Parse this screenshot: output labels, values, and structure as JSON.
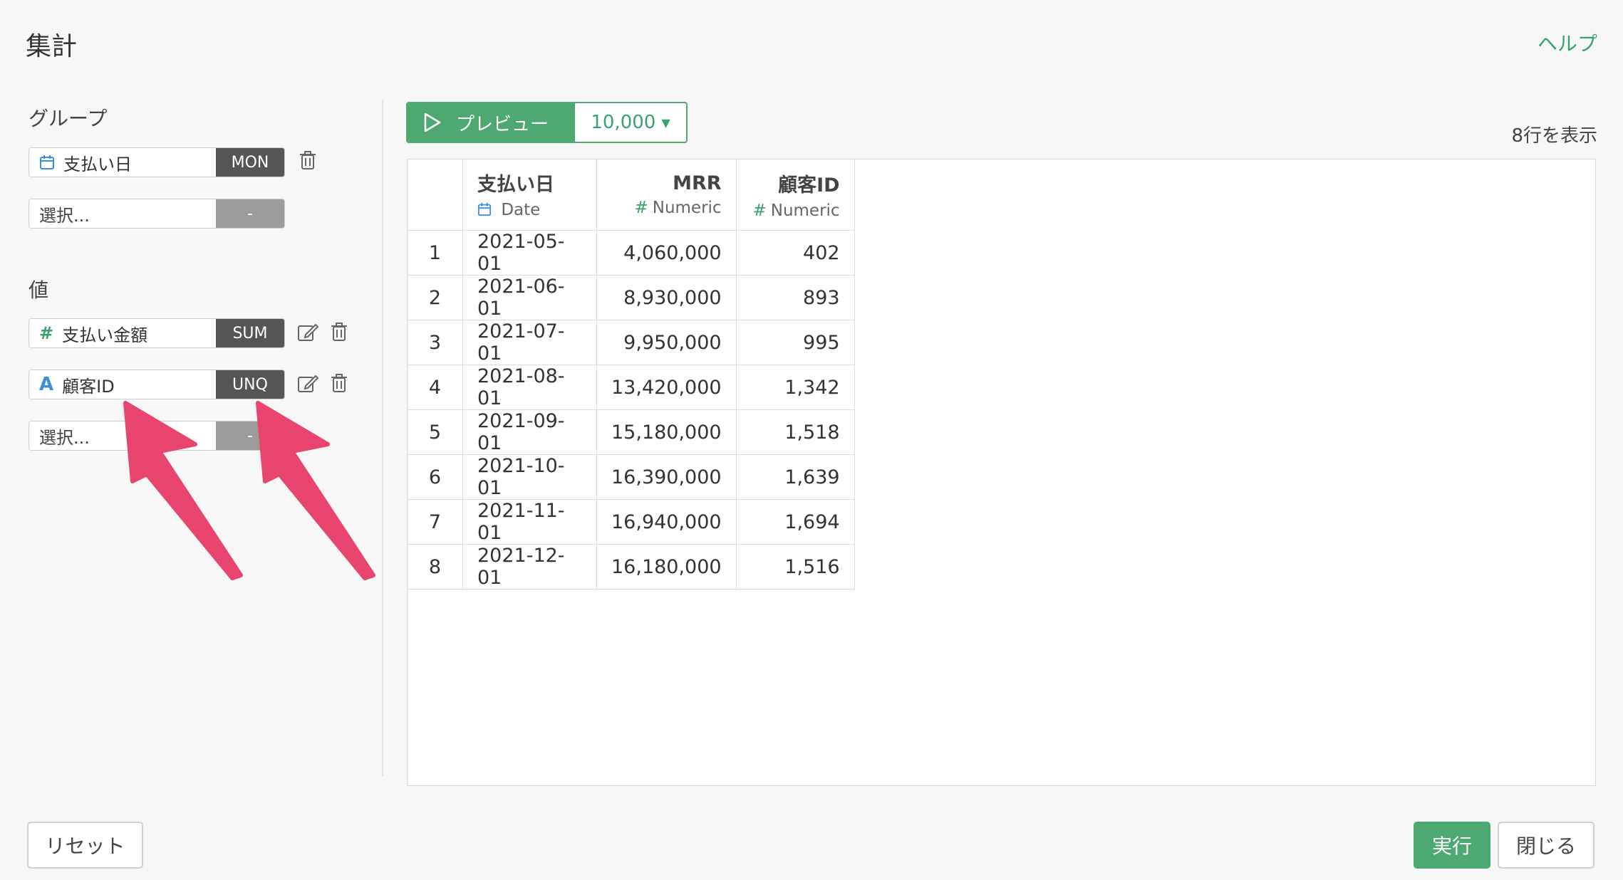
{
  "header": {
    "title": "集計",
    "help": "ヘルプ"
  },
  "groups": {
    "label": "グループ",
    "items": [
      {
        "name": "支払い日",
        "type_icon": "calendar-icon",
        "agg": "MON"
      }
    ],
    "placeholder": {
      "name": "選択...",
      "agg": "-"
    }
  },
  "values": {
    "label": "値",
    "items": [
      {
        "name": "支払い金額",
        "type_icon": "numeric-hash-icon",
        "type_glyph": "#",
        "agg": "SUM"
      },
      {
        "name": "顧客ID",
        "type_icon": "text-a-icon",
        "type_glyph": "A",
        "agg": "UNQ"
      }
    ],
    "placeholder": {
      "name": "選択...",
      "agg": "-"
    }
  },
  "preview": {
    "button_label": "プレビュー",
    "count": "10,000",
    "rows_info": "8行を表示"
  },
  "table": {
    "columns": [
      {
        "name": "支払い日",
        "type": "Date",
        "type_icon": "calendar-icon"
      },
      {
        "name": "MRR",
        "type": "Numeric",
        "type_glyph": "#"
      },
      {
        "name": "顧客ID",
        "type": "Numeric",
        "type_glyph": "#"
      }
    ],
    "rows": [
      [
        "1",
        "2021-05-01",
        "4,060,000",
        "402"
      ],
      [
        "2",
        "2021-06-01",
        "8,930,000",
        "893"
      ],
      [
        "3",
        "2021-07-01",
        "9,950,000",
        "995"
      ],
      [
        "4",
        "2021-08-01",
        "13,420,000",
        "1,342"
      ],
      [
        "5",
        "2021-09-01",
        "15,180,000",
        "1,518"
      ],
      [
        "6",
        "2021-10-01",
        "16,390,000",
        "1,639"
      ],
      [
        "7",
        "2021-11-01",
        "16,940,000",
        "1,694"
      ],
      [
        "8",
        "2021-12-01",
        "16,180,000",
        "1,516"
      ]
    ]
  },
  "footer": {
    "reset": "リセット",
    "execute": "実行",
    "close": "閉じる"
  },
  "colors": {
    "accent": "#4ea872",
    "agg_bg": "#555555",
    "annotation_arrow": "#e8456e"
  }
}
